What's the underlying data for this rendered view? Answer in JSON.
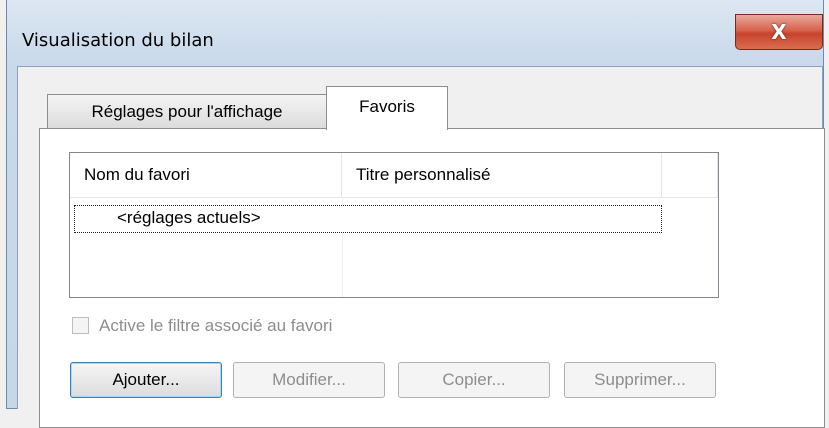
{
  "window": {
    "title": "Visualisation du bilan",
    "close_label": "X"
  },
  "tabs": [
    {
      "label": "Réglages pour l'affichage",
      "active": false
    },
    {
      "label": "Favoris",
      "active": true
    }
  ],
  "favorites_list": {
    "columns": [
      "Nom du favori",
      "Titre personnalisé",
      ""
    ],
    "rows": [
      {
        "name": "<réglages actuels>",
        "custom_title": "",
        "selected": true
      }
    ]
  },
  "filter_checkbox": {
    "label": "Active le filtre associé au favori",
    "checked": false,
    "enabled": false
  },
  "buttons": {
    "add": "Ajouter...",
    "modify": "Modifier...",
    "copy": "Copier...",
    "delete": "Supprimer..."
  },
  "colors": {
    "close_button": "#c7432c",
    "title_bar": "#c9d9eb",
    "focus_border": "#3c7fb1",
    "disabled_text": "#8d8d8d"
  }
}
